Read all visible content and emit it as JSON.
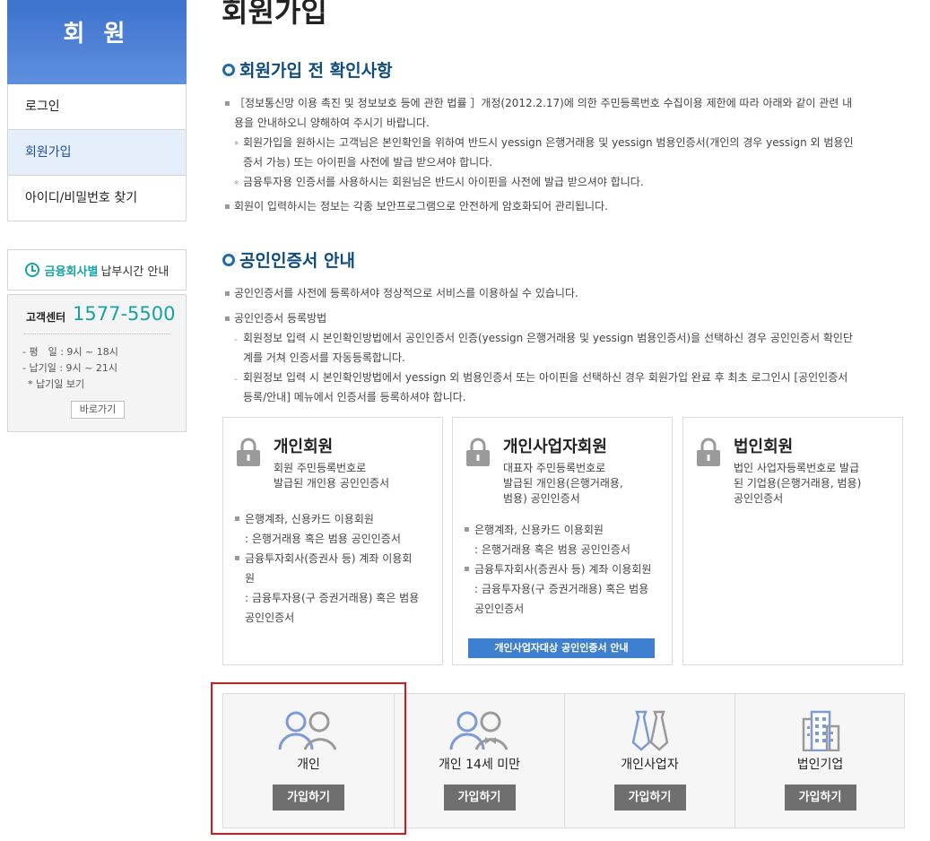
{
  "sidebar": {
    "header": "회 원",
    "items": [
      {
        "label": "로그인",
        "active": false
      },
      {
        "label": "회원가입",
        "active": true
      },
      {
        "label": "아이디/비밀번호 찾기",
        "active": false
      }
    ],
    "pay_time": {
      "highlight": "금융회사별",
      "label": "납부시간 안내"
    },
    "customer_center": {
      "title": "고객센터",
      "phone": "1577-5500",
      "lines": [
        "- 평　일 : 9시 ~ 18시",
        "- 납기일 : 9시 ~ 21시",
        "* 납기일 보기"
      ],
      "button": "바로가기"
    }
  },
  "main": {
    "page_title": "회원가입",
    "section1": {
      "title": "회원가입 전 확인사항",
      "p1a": "［정보통신망 이용 촉진 및 정보보호 등에 관한 법률 ］개정(2012.2.17)에 의한 주민등록번호 수집이용 제한에 따라 아래와 같이 관련 내",
      "p1b": "용을 안내하오니 양해하여 주시기 바랍니다.",
      "s1a": "회원가입을 원하시는 고객님은 본인확인을 위하여 반드시 yessign 은행거래용 및 yessign 범용인증서(개인의 경우 yessign 외 범용인",
      "s1b": "증서 가능) 또는 아이핀을 사전에 발급 받으셔야 합니다.",
      "s2": "금융투자용 인증서를 사용하시는 회원님은 반드시 아이핀을 사전에 발급 받으셔야 합니다.",
      "p2": "회원이 입력하시는 정보는 각종 보안프로그램으로 안전하게 암호화되어 관리됩니다."
    },
    "section2": {
      "title": "공인인증서 안내",
      "p1": "공인인증서를 사전에 등록하셔야 정상적으로 서비스를 이용하실 수 있습니다.",
      "p2": "공인인증서 등록방법",
      "d1a": "회원정보 입력 시 본인확인방법에서 공인인증서 인증(yessign 은행거래용 및 yessign 범용인증서)을 선택하신 경우 공인인증서 확인단",
      "d1b": "계를 거쳐 인증서를 자동등록합니다.",
      "d2a": "회원정보 입력 시 본인확인방법에서 yessign 외 범용인증서 또는 아이핀을 선택하신 경우 회원가입 완료 후 최초 로그인시 [공인인증서",
      "d2b": "등록/안내] 메뉴에서 인증서를 등록하셔야 합니다."
    },
    "cards": [
      {
        "title": "개인회원",
        "desc": [
          "회원 주민등록번호로",
          "발급된 개인용 공인인증서"
        ],
        "l1": "은행계좌, 신용카드 이용회원",
        "l1b": ": 은행거래용 혹은 범용 공인인증서",
        "l2": "금융투자회사(증권사 등) 계좌 이용회",
        "l2b": "원",
        "l2c": ": 금융투자용(구 증권거래용) 혹은 범용",
        "l2d": "공인인증서"
      },
      {
        "title": "개인사업자회원",
        "desc": [
          "대표자 주민등록번호로",
          "발급된 개인용(은행거래용,",
          "범용) 공인인증서"
        ],
        "l1": "은행계좌, 신용카드 이용회원",
        "l1b": ": 은행거래용 혹은 범용 공인인증서",
        "l2": "금융투자회사(증권사 등) 계좌 이용회원",
        "l2c": ": 금융투자용(구 증권거래용) 혹은 범용",
        "l2d": "공인인증서",
        "button": "개인사업자대상 공인인증서 안내"
      },
      {
        "title": "법인회원",
        "desc": [
          "법인 사업자등록번호로 발급",
          "된 기업용(은행거래용, 범용)",
          "공인인증서"
        ]
      }
    ],
    "join": [
      {
        "label": "개인",
        "button": "가입하기"
      },
      {
        "label": "개인 14세 미만",
        "button": "가입하기"
      },
      {
        "label": "개인사업자",
        "button": "가입하기"
      },
      {
        "label": "법인기업",
        "button": "가입하기"
      }
    ]
  },
  "colors": {
    "accent": "#1b6bb5",
    "teal": "#16a3a3",
    "highlight": "#e0141b"
  }
}
